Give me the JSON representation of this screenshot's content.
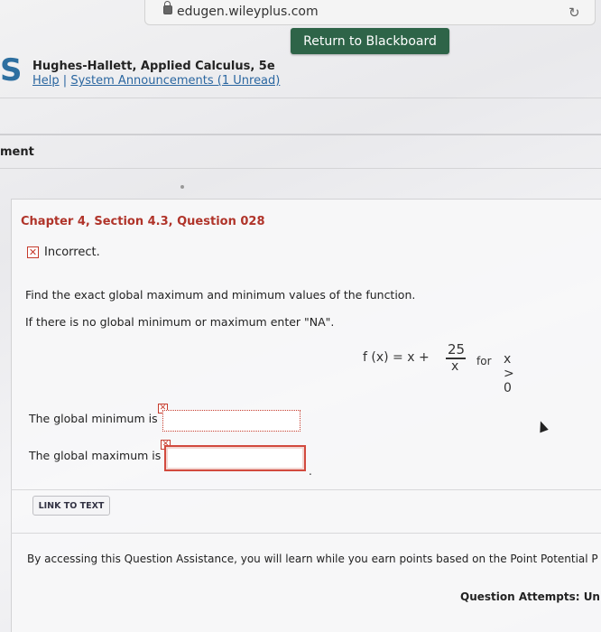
{
  "browser": {
    "url": "edugen.wileyplus.com"
  },
  "header": {
    "return_button": "Return to Blackboard",
    "logo_letter": "S",
    "book_title": "Hughes-Hallett, Applied Calculus, 5e",
    "help_link": "Help",
    "separator": "|",
    "announcements_link": "System Announcements (1 Unread)"
  },
  "assignment_label": "ment",
  "question": {
    "title": "Chapter 4, Section 4.3, Question 028",
    "status_mark": "✕",
    "status_text": "Incorrect.",
    "prompt_1": "Find the exact global maximum and minimum values of the function.",
    "prompt_2": "If there is no global minimum or maximum enter \"NA\".",
    "formula": {
      "lhs": "f (x) = x +",
      "numerator": "25",
      "denominator": "x",
      "for_word": "for",
      "condition": "x > 0"
    },
    "answers": [
      {
        "label": "The global minimum is",
        "value": ""
      },
      {
        "label": "The global maximum is",
        "value": ""
      }
    ],
    "period": "."
  },
  "link_to_text": "LINK TO TEXT",
  "assistance_text": "By accessing this Question Assistance, you will learn while you earn points based on the Point Potential P",
  "attempts_text": "Question Attempts: Unl"
}
